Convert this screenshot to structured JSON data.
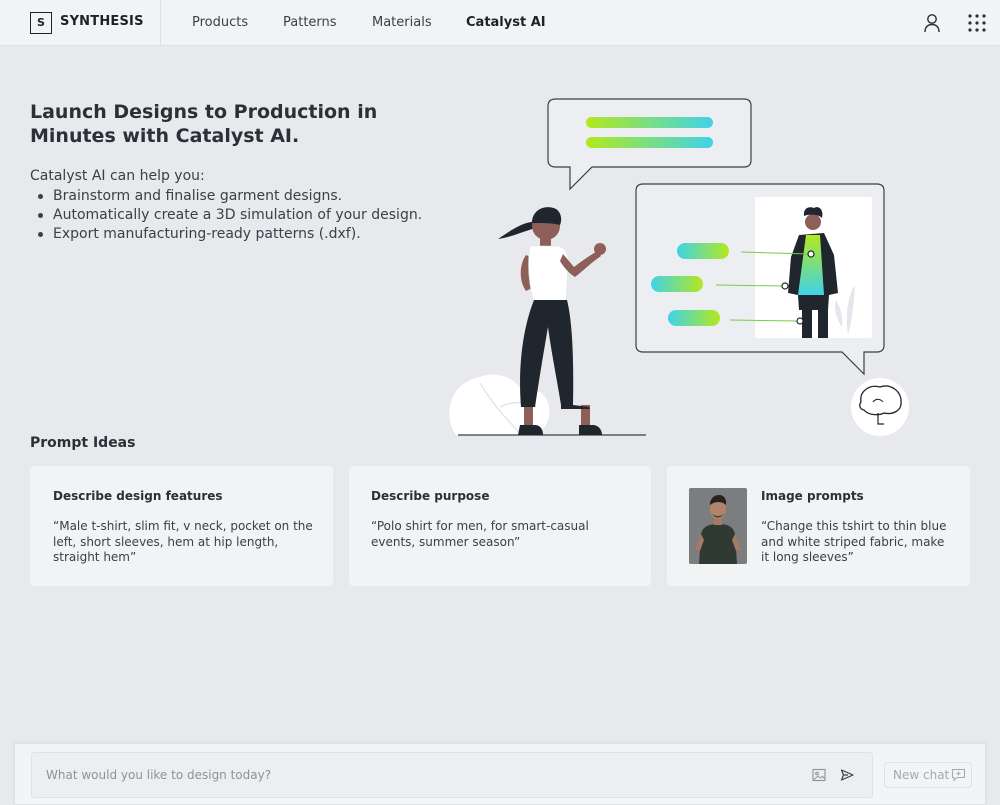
{
  "brand": {
    "logo_letter": "S",
    "name": "SYNTHESIS"
  },
  "nav": {
    "items": [
      "Products",
      "Patterns",
      "Materials",
      "Catalyst AI"
    ],
    "active": "Catalyst AI"
  },
  "header_icons": [
    "user-icon",
    "apps-grid-icon"
  ],
  "hero": {
    "title": "Launch Designs to Production in Minutes with Catalyst AI.",
    "intro": "Catalyst AI can help you:",
    "bullets": [
      "Brainstorm and finalise garment designs.",
      "Automatically create a 3D simulation of your design.",
      "Export manufacturing-ready patterns (.dxf)."
    ]
  },
  "prompt_ideas": {
    "title": "Prompt Ideas",
    "cards": [
      {
        "title": "Describe design features",
        "text": "“Male t-shirt, slim fit, v neck, pocket on the left, short sleeves, hem at hip length, straight hem”"
      },
      {
        "title": "Describe purpose",
        "text": "“Polo shirt for men, for smart-casual events, summer season”"
      },
      {
        "title": "Image prompts",
        "text": "“Change this tshirt to thin blue and white striped fabric, make it long sleeves”"
      }
    ]
  },
  "chat": {
    "placeholder": "What would you like to design today?",
    "new_chat_label": "New chat",
    "icons": [
      "image-upload-icon",
      "send-icon",
      "new-chat-icon"
    ]
  },
  "colors": {
    "gradient_green": "#b4e81e",
    "gradient_cyan": "#3fd3e8",
    "skin": "#8e5f59",
    "dark": "#1f262d"
  }
}
